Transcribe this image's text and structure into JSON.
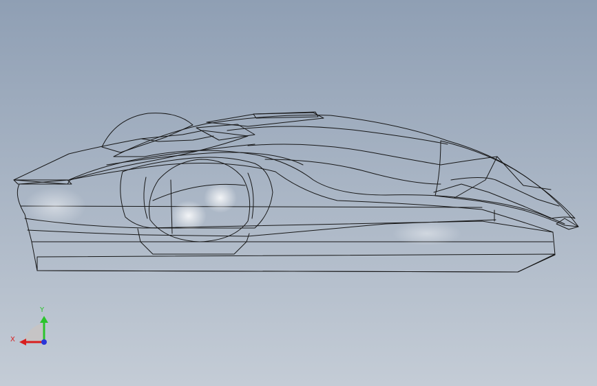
{
  "viewport": {
    "background_top": "#8f9fb4",
    "background_bottom": "#c4ccd6"
  },
  "model": {
    "shell_color": "#d4d6c6",
    "shadow_color": "#3a3d33",
    "edge_color": "#161616"
  },
  "triad": {
    "y_label": "Y",
    "x_label": "X",
    "y_color": "#2bc42b",
    "x_color": "#d81e1e",
    "z_color": "#2a36d8"
  }
}
